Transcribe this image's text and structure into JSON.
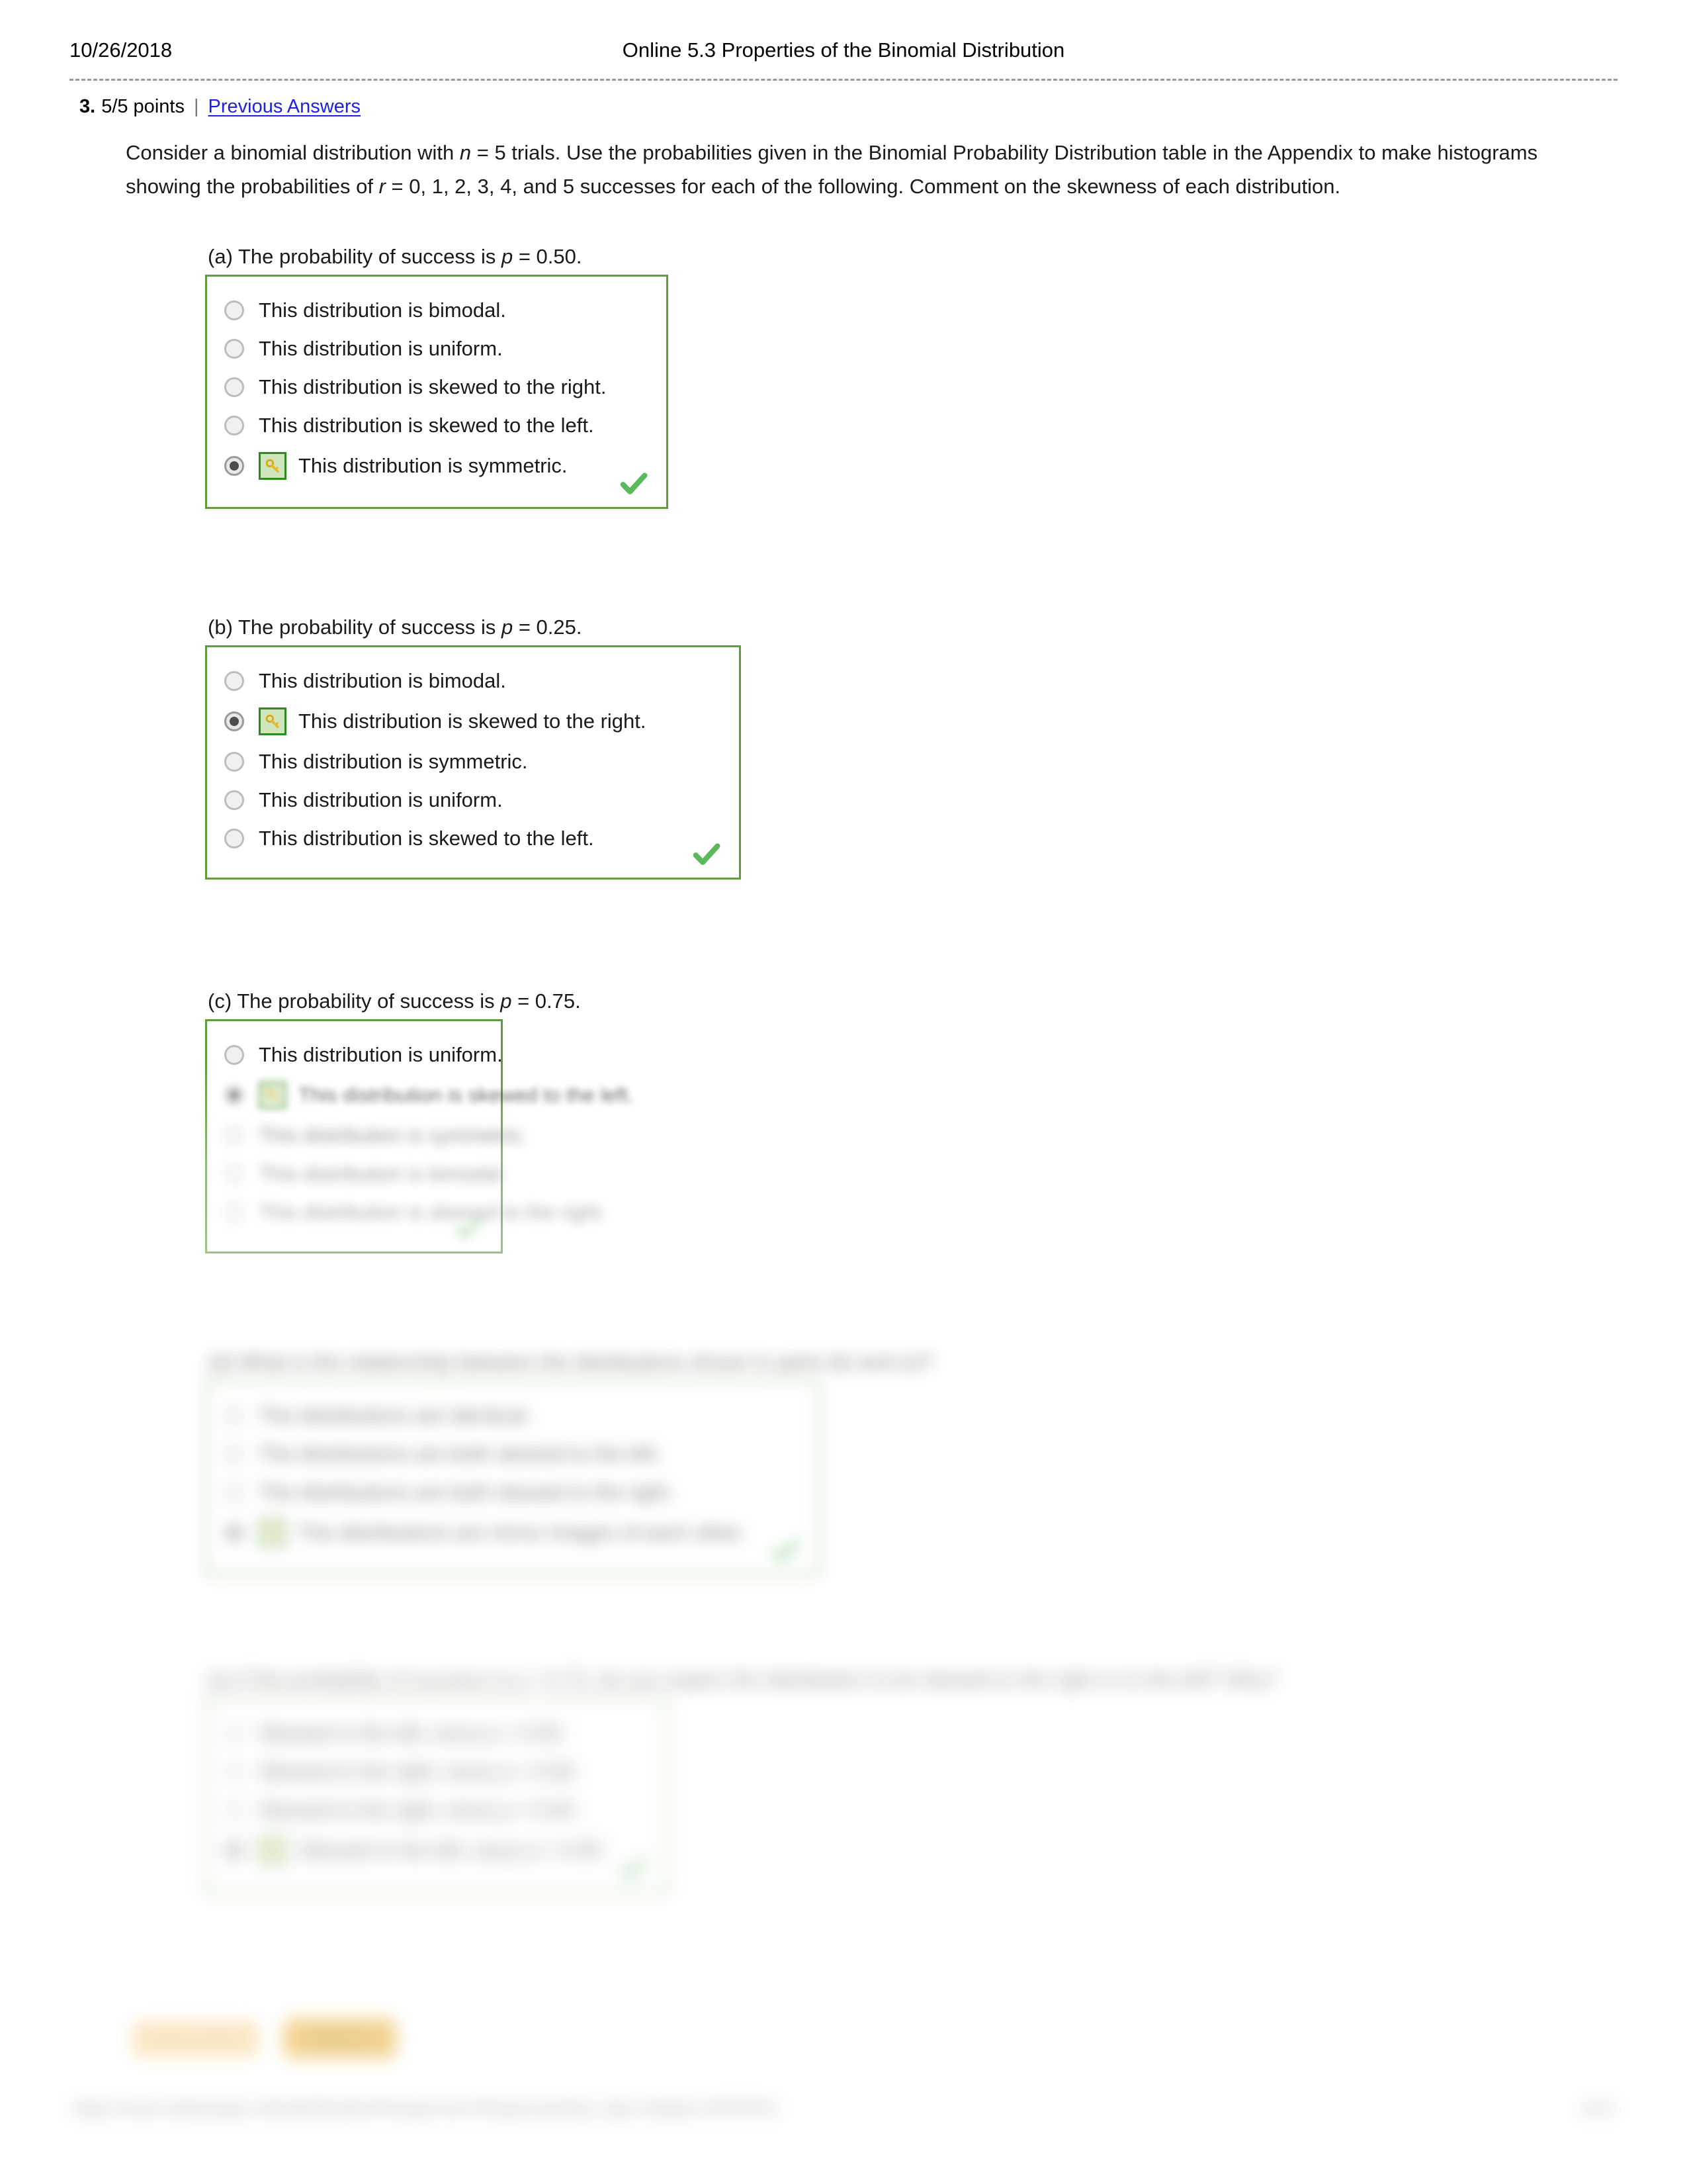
{
  "header": {
    "date": "10/26/2018",
    "title": "Online 5.3 Properties of the Binomial Distribution"
  },
  "meta": {
    "number": "3.",
    "points": "5/5 points",
    "separator": "|",
    "previous_answers_link": "Previous Answers"
  },
  "question": {
    "stem_1": "Consider a binomial distribution with ",
    "stem_n": "n",
    "stem_2": " = 5 trials. Use the probabilities given in the Binomial Probability Distribution table in the Appendix to make histograms showing the probabilities of ",
    "stem_r": "r",
    "stem_3": " = 0, 1, 2, 3, 4, and 5 successes for each of the following. Comment on the skewness of each distribution."
  },
  "parts": [
    {
      "id": "a",
      "label_pre": "(a) The probability of success is ",
      "label_var": "p",
      "label_post": " = 0.50.",
      "options": [
        {
          "text": "This distribution is bimodal.",
          "selected": false,
          "key": false
        },
        {
          "text": "This distribution is uniform.",
          "selected": false,
          "key": false
        },
        {
          "text": "This distribution is skewed to the right.",
          "selected": false,
          "key": false
        },
        {
          "text": "This distribution is skewed to the left.",
          "selected": false,
          "key": false
        },
        {
          "text": "This distribution is symmetric.",
          "selected": true,
          "key": true
        }
      ],
      "correct": true
    },
    {
      "id": "b",
      "label_pre": "(b) The probability of success is ",
      "label_var": "p",
      "label_post": " = 0.25.",
      "options": [
        {
          "text": "This distribution is bimodal.",
          "selected": false,
          "key": false
        },
        {
          "text": "This distribution is skewed to the right.",
          "selected": true,
          "key": true
        },
        {
          "text": "This distribution is symmetric.",
          "selected": false,
          "key": false
        },
        {
          "text": "This distribution is uniform.",
          "selected": false,
          "key": false
        },
        {
          "text": "This distribution is skewed to the left.",
          "selected": false,
          "key": false
        }
      ],
      "correct": true
    },
    {
      "id": "c",
      "label_pre": "(c) The probability of success is ",
      "label_var": "p",
      "label_post": " = 0.75.",
      "options": [
        {
          "text": "This distribution is uniform.",
          "selected": false,
          "key": false
        },
        {
          "text": "This distribution is skewed to the left.",
          "selected": true,
          "key": true
        },
        {
          "text": "This distribution is symmetric.",
          "selected": false,
          "key": false
        },
        {
          "text": "This distribution is bimodal.",
          "selected": false,
          "key": false
        },
        {
          "text": "This distribution is skewed to the right.",
          "selected": false,
          "key": false
        }
      ],
      "correct": true
    },
    {
      "id": "d",
      "label_pre": "(d) What is the relationship between the distributions shown in parts (b) and (c)?",
      "label_var": "",
      "label_post": "",
      "options": [
        {
          "text": "The distributions are identical.",
          "selected": false,
          "key": false
        },
        {
          "text": "The distributions are both skewed to the left.",
          "selected": false,
          "key": false
        },
        {
          "text": "The distributions are both skewed to the right.",
          "selected": false,
          "key": false
        },
        {
          "text": "The distributions are mirror images of each other.",
          "selected": true,
          "key": true
        }
      ],
      "correct": true
    },
    {
      "id": "e",
      "label_pre": "(e) If the probability of success is p = 0.73, do you expect the distribution to be skewed to the right or to the left? Why?",
      "label_var": "",
      "label_post": "",
      "options": [
        {
          "text": "Skewed to the left, since p < 0.50",
          "selected": false,
          "key": false
        },
        {
          "text": "Skewed to the right, since p > 0.50",
          "selected": false,
          "key": false
        },
        {
          "text": "Skewed to the right, since p < 0.50",
          "selected": false,
          "key": false
        },
        {
          "text": "Skewed to the left, since p > 0.50",
          "selected": true,
          "key": true
        }
      ],
      "correct": true
    }
  ],
  "actions": {
    "need_help_label": "Need Help?",
    "primary_label": "Read It"
  },
  "footer": {
    "url": "https://www.webassign.net/web/Student/Assignment-Responses/last_dep=1&dep=19746751",
    "page": "2/12"
  },
  "icons": {
    "key": "key-icon",
    "check": "check-icon"
  },
  "colors": {
    "box_border_green": "#5f9c3d",
    "check_green": "#5cb85c",
    "key_badge_bg": "#cfe5bc",
    "key_badge_border": "#2e8b22",
    "link_blue": "#1d20e8",
    "button_orange": "#e8a723"
  }
}
